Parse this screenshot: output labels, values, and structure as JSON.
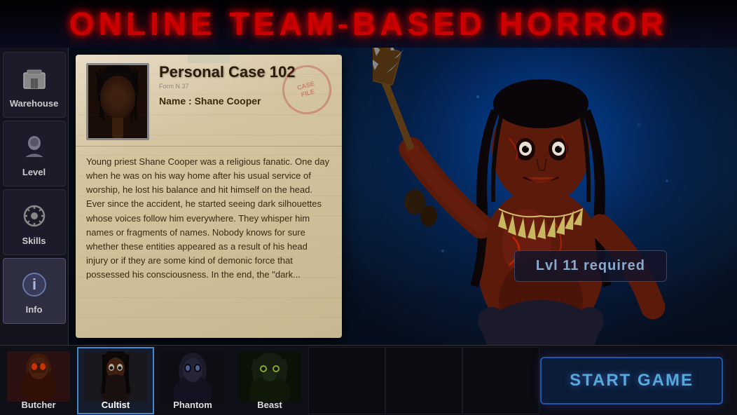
{
  "app": {
    "title": "ONLINE TEAM-BASED HORROR"
  },
  "sidebar": {
    "items": [
      {
        "id": "warehouse",
        "label": "Warehouse",
        "icon": "🎒"
      },
      {
        "id": "level",
        "label": "Level",
        "icon": "👤"
      },
      {
        "id": "skills",
        "label": "Skills",
        "icon": "⚙️"
      },
      {
        "id": "info",
        "label": "Info",
        "icon": "ℹ️",
        "active": true
      }
    ]
  },
  "case": {
    "title": "Personal Case 102",
    "form_label": "Form N 37",
    "name_label": "Name : Shane Cooper",
    "description": "Young priest Shane Cooper was a religious fanatic. One day when he was on his way home after his usual service of worship, he lost his balance and hit himself on the head. Ever since the accident, he started seeing dark silhouettes whose voices follow him everywhere. They whisper him names or fragments of names. Nobody knows for sure whether these entities appeared as a result of his head injury or if they are some kind of demonic force that possessed his consciousness. In the end, the \"dark..."
  },
  "monster": {
    "level_required": "Lvl 11 required"
  },
  "characters": [
    {
      "id": "butcher",
      "label": "Butcher",
      "selected": false
    },
    {
      "id": "cultist",
      "label": "Cultist",
      "selected": true
    },
    {
      "id": "phantom",
      "label": "Phantom",
      "selected": false
    },
    {
      "id": "beast",
      "label": "Beast",
      "selected": false
    }
  ],
  "buttons": {
    "start_game": "START GAME"
  },
  "colors": {
    "title_red": "#cc0000",
    "accent_blue": "#55aadd",
    "selected_border": "#4488cc"
  }
}
